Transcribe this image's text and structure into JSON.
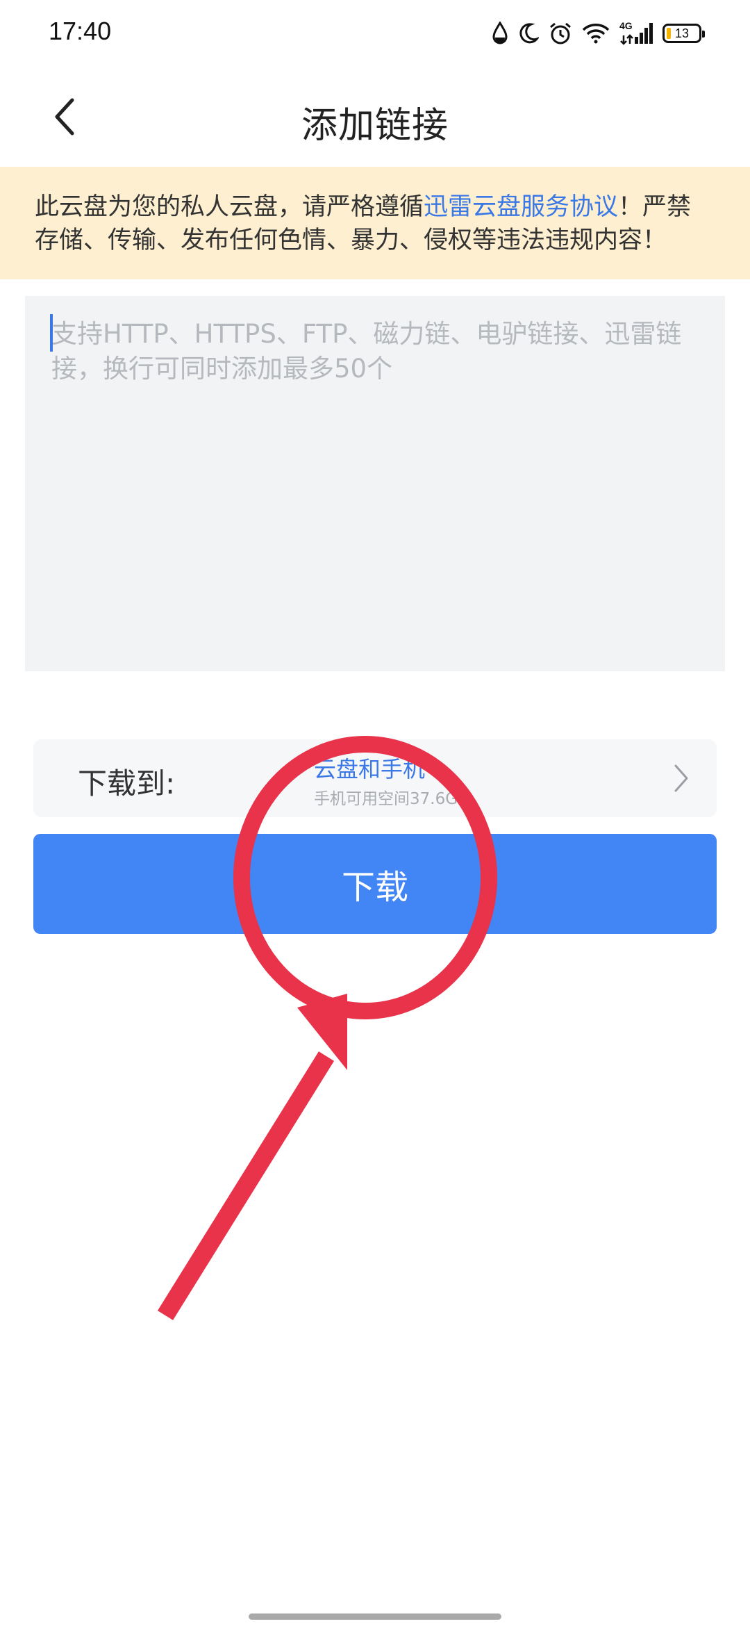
{
  "status_bar": {
    "time": "17:40",
    "network": "4G",
    "battery": "13",
    "icons": [
      "water-drop-icon",
      "moon-icon",
      "alarm-icon",
      "wifi-icon",
      "signal-icon",
      "battery-icon"
    ]
  },
  "header": {
    "title": "添加链接",
    "back_icon": "chevron-left-icon"
  },
  "notice": {
    "text_before": "此云盘为您的私人云盘，请严格遵循",
    "link_text": "迅雷云盘服务协议",
    "text_after": "！严禁存储、传输、发布任何色情、暴力、侵权等违法违规内容！"
  },
  "link_input": {
    "value": "",
    "placeholder": "支持HTTP、HTTPS、FTP、磁力链、电驴链接、迅雷链接，换行可同时添加最多50个"
  },
  "download_to": {
    "label": "下载到:",
    "target": "云盘和手机",
    "space": "手机可用空间37.6G",
    "chevron_icon": "chevron-right-icon"
  },
  "download_button": {
    "label": "下载"
  },
  "colors": {
    "accent": "#4285f4",
    "link": "#3a78e6",
    "notice_bg": "#fdefd0",
    "input_bg": "#f2f3f5",
    "annotation": "#e8334a"
  }
}
